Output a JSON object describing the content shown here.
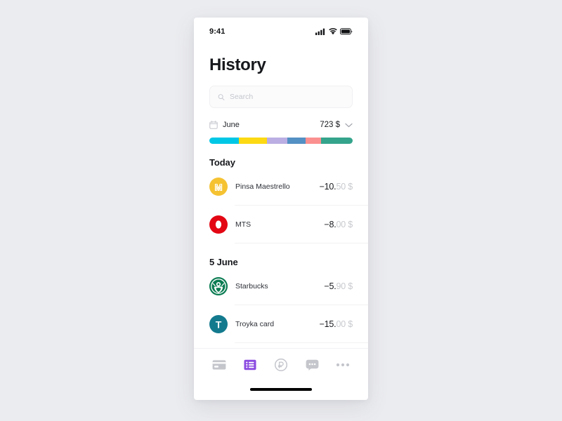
{
  "status_bar": {
    "time": "9:41",
    "icons": [
      "cellular-signal-icon",
      "wifi-icon",
      "battery-icon"
    ]
  },
  "header": {
    "title": "History"
  },
  "search": {
    "placeholder": "Search",
    "value": "",
    "icon": "search-icon"
  },
  "month_summary": {
    "calendar_icon": "calendar-icon",
    "month": "June",
    "total": "723 $",
    "chevron_icon": "chevron-down-icon",
    "breakdown": [
      {
        "label": "segment-1",
        "color": "#00c7e5",
        "percent": 20.5
      },
      {
        "label": "segment-2",
        "color": "#fcd913",
        "percent": 19.5
      },
      {
        "label": "segment-3",
        "color": "#bbaee3",
        "percent": 14.5
      },
      {
        "label": "segment-4",
        "color": "#5390c4",
        "percent": 12.5
      },
      {
        "label": "segment-5",
        "color": "#fb9090",
        "percent": 11.0
      },
      {
        "label": "segment-6",
        "color": "#35a48c",
        "percent": 22.0
      }
    ]
  },
  "sections": [
    {
      "title": "Today",
      "transactions": [
        {
          "name": "Pinsa Maestrello",
          "amount_main": "−10.",
          "amount_frac": "50 $",
          "avatar": {
            "icon": "pinsa-maestrello-logo",
            "color": "#f5c231",
            "letter": "M"
          }
        },
        {
          "name": "MTS",
          "amount_main": "−8.",
          "amount_frac": "00 $",
          "avatar": {
            "icon": "mts-logo",
            "color": "#e30613",
            "letter": ""
          }
        }
      ]
    },
    {
      "title": "5 June",
      "transactions": [
        {
          "name": "Starbucks",
          "amount_main": "−5.",
          "amount_frac": "90 $",
          "avatar": {
            "icon": "starbucks-logo",
            "color": "#0b7c52",
            "letter": ""
          }
        },
        {
          "name": "Troyka card",
          "amount_main": "−15.",
          "amount_frac": "00 $",
          "avatar": {
            "icon": "troyka-card-logo",
            "color": "#137a8e",
            "letter": "T"
          }
        }
      ]
    }
  ],
  "tab_bar": {
    "active_color": "#8b4be0",
    "inactive_color": "#c4c6cc",
    "items": [
      {
        "name": "cards",
        "icon": "credit-card-icon",
        "active": false
      },
      {
        "name": "history",
        "icon": "list-icon",
        "active": true
      },
      {
        "name": "payments",
        "icon": "ruble-coin-icon",
        "active": false
      },
      {
        "name": "chat",
        "icon": "chat-bubble-icon",
        "active": false
      },
      {
        "name": "more",
        "icon": "more-dots-icon",
        "active": false
      }
    ]
  }
}
